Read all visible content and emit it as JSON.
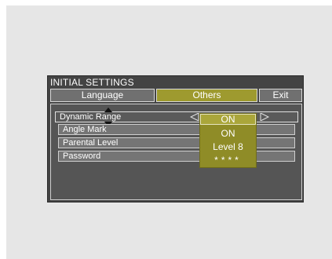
{
  "menu": {
    "title": "INITIAL SETTINGS",
    "tabs": [
      {
        "label": "Language"
      },
      {
        "label": "Others"
      },
      {
        "label": "Exit"
      }
    ],
    "rows": [
      {
        "label": "Dynamic Range"
      },
      {
        "label": "Angle Mark"
      },
      {
        "label": "Parental Level"
      },
      {
        "label": "Password"
      }
    ],
    "dropdown": {
      "selected": "ON",
      "options": [
        "ON",
        "Level 8",
        "****"
      ]
    }
  },
  "colors": {
    "accent": "#9e9a2f",
    "panel": "#444444",
    "tab_inactive": "#707070"
  },
  "icons": [
    "caret-up-icon",
    "caret-down-icon",
    "left-arrow-icon",
    "right-arrow-icon"
  ]
}
